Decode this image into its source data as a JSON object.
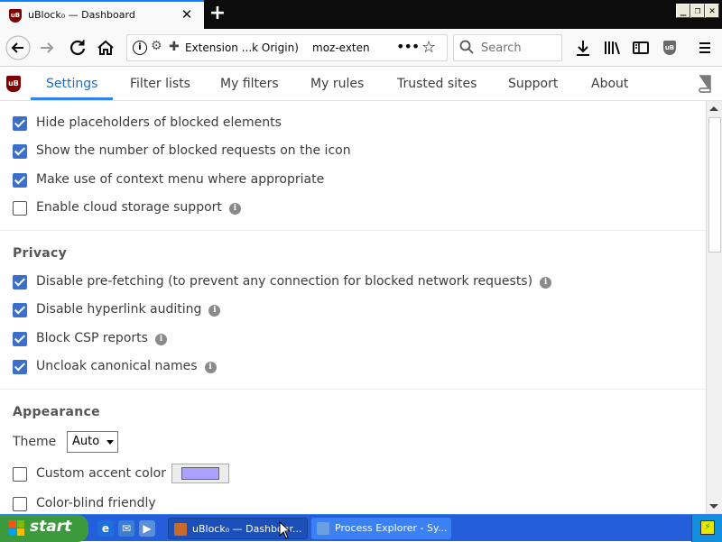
{
  "browser": {
    "tab_title": "uBlock₀ — Dashboard",
    "favicon_text": "uB",
    "close_tab_glyph": "✕",
    "new_tab_glyph": "+",
    "window_controls": [
      "_",
      "❐",
      "✕"
    ]
  },
  "navbar": {
    "identity_label": "Extension ...k Origin)",
    "url": "moz-exten",
    "search_placeholder": "Search",
    "page_actions_glyph": "•••"
  },
  "dashboard": {
    "tabs": [
      {
        "label": "Settings",
        "active": true
      },
      {
        "label": "Filter lists",
        "active": false
      },
      {
        "label": "My filters",
        "active": false
      },
      {
        "label": "My rules",
        "active": false
      },
      {
        "label": "Trusted sites",
        "active": false
      },
      {
        "label": "Support",
        "active": false
      },
      {
        "label": "About",
        "active": false
      }
    ]
  },
  "settings": {
    "general_items": [
      {
        "label": "Hide placeholders of blocked elements",
        "checked": true,
        "info": false
      },
      {
        "label": "Show the number of blocked requests on the icon",
        "checked": true,
        "info": false
      },
      {
        "label": "Make use of context menu where appropriate",
        "checked": true,
        "info": false
      },
      {
        "label": "Enable cloud storage support",
        "checked": false,
        "info": true
      }
    ],
    "privacy_title": "Privacy",
    "privacy_items": [
      {
        "label": "Disable pre-fetching (to prevent any connection for blocked network requests)",
        "checked": true,
        "info": true
      },
      {
        "label": "Disable hyperlink auditing",
        "checked": true,
        "info": true
      },
      {
        "label": "Block CSP reports",
        "checked": true,
        "info": true
      },
      {
        "label": "Uncloak canonical names",
        "checked": true,
        "info": true
      }
    ],
    "appearance_title": "Appearance",
    "theme_label": "Theme",
    "theme_value": "Auto",
    "appearance_items": [
      {
        "label": "Custom accent color",
        "checked": false,
        "info": false
      },
      {
        "label": "Color-blind friendly",
        "checked": false,
        "info": false
      }
    ],
    "accent_color": "#aaa0ff",
    "info_glyph": "i"
  },
  "taskbar": {
    "start_label": "start",
    "tasks": [
      {
        "label": "uBlock₀ — Dashboar...",
        "active": true
      },
      {
        "label": "Process Explorer - Sy...",
        "active": false
      }
    ]
  },
  "colors": {
    "active_tab": "#1d6bc8",
    "checkbox": "#3c6fc9",
    "ubo_brand": "#800000",
    "taskbar": "#245edb",
    "start": "#3c9a3c"
  }
}
